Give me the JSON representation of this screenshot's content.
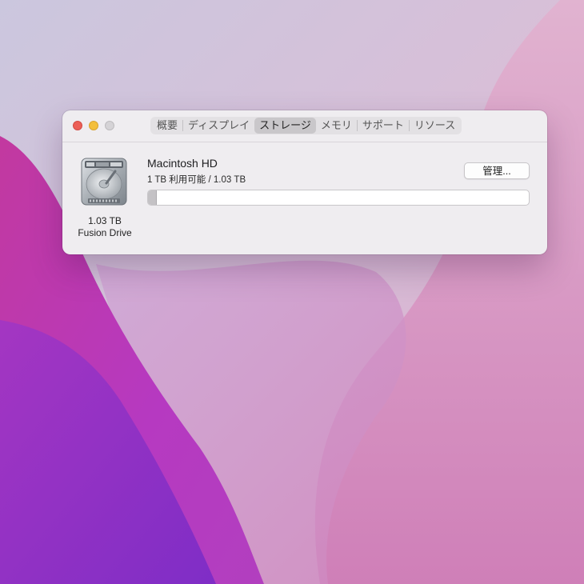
{
  "window": {
    "tabs": [
      {
        "label": "概要",
        "active": false
      },
      {
        "label": "ディスプレイ",
        "active": false
      },
      {
        "label": "ストレージ",
        "active": true
      },
      {
        "label": "メモリ",
        "active": false
      },
      {
        "label": "サポート",
        "active": false
      },
      {
        "label": "リソース",
        "active": false
      }
    ]
  },
  "drive": {
    "icon": "hard-drive-icon",
    "capacity": "1.03 TB",
    "type": "Fusion Drive"
  },
  "volume": {
    "name": "Macintosh HD",
    "info": "1 TB 利用可能 / 1.03 TB",
    "used_fraction": 0.02,
    "manage_label": "管理..."
  },
  "colors": {
    "wallpaper_light": "#d9c6dc",
    "wallpaper_magenta": "#b535c0",
    "wallpaper_purple": "#8e2fc4",
    "window_bg": "#efedf0"
  }
}
